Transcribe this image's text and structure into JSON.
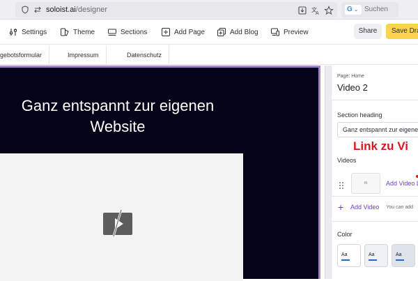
{
  "browser": {
    "url_domain": "soloist.ai",
    "url_path": "/designer",
    "search_badge": "G",
    "search_placeholder": "Suchen"
  },
  "toolbar": {
    "items": [
      {
        "label": "Settings",
        "icon": "sliders-icon"
      },
      {
        "label": "Theme",
        "icon": "theme-icon"
      },
      {
        "label": "Sections",
        "icon": "sections-icon"
      },
      {
        "label": "Add Page",
        "icon": "add-page-icon"
      },
      {
        "label": "Add Blog",
        "icon": "add-blog-icon"
      },
      {
        "label": "Preview",
        "icon": "preview-icon"
      }
    ],
    "share_label": "Share",
    "save_label": "Save Dra"
  },
  "page_tabs": [
    "gebotsformular",
    "Impressum",
    "Datenschutz"
  ],
  "canvas": {
    "hero_title": "Ganz entspannt zur eigenen Website",
    "hero_bg": "#050418",
    "selection_color": "#a682d8"
  },
  "panel": {
    "page_label": "Page: Home",
    "section_title": "Video 2",
    "section_heading_label": "Section heading",
    "section_heading_value": "Ganz entspannt zur eigenen",
    "annotation": "Link zu Vi",
    "videos_label": "Videos",
    "video_thumb_text": "m",
    "add_video_link": "Add Video L",
    "add_video_button": "Add Video",
    "add_hint": "You can add",
    "color_label": "Color",
    "swatches": [
      {
        "label": "Aa",
        "bg": "#ffffff"
      },
      {
        "label": "Aa",
        "bg": "#eef1f6"
      },
      {
        "label": "Aa",
        "bg": "#dfe3ec"
      }
    ],
    "accent_color": "#6a3fd0",
    "annotation_color": "#e0141e"
  }
}
